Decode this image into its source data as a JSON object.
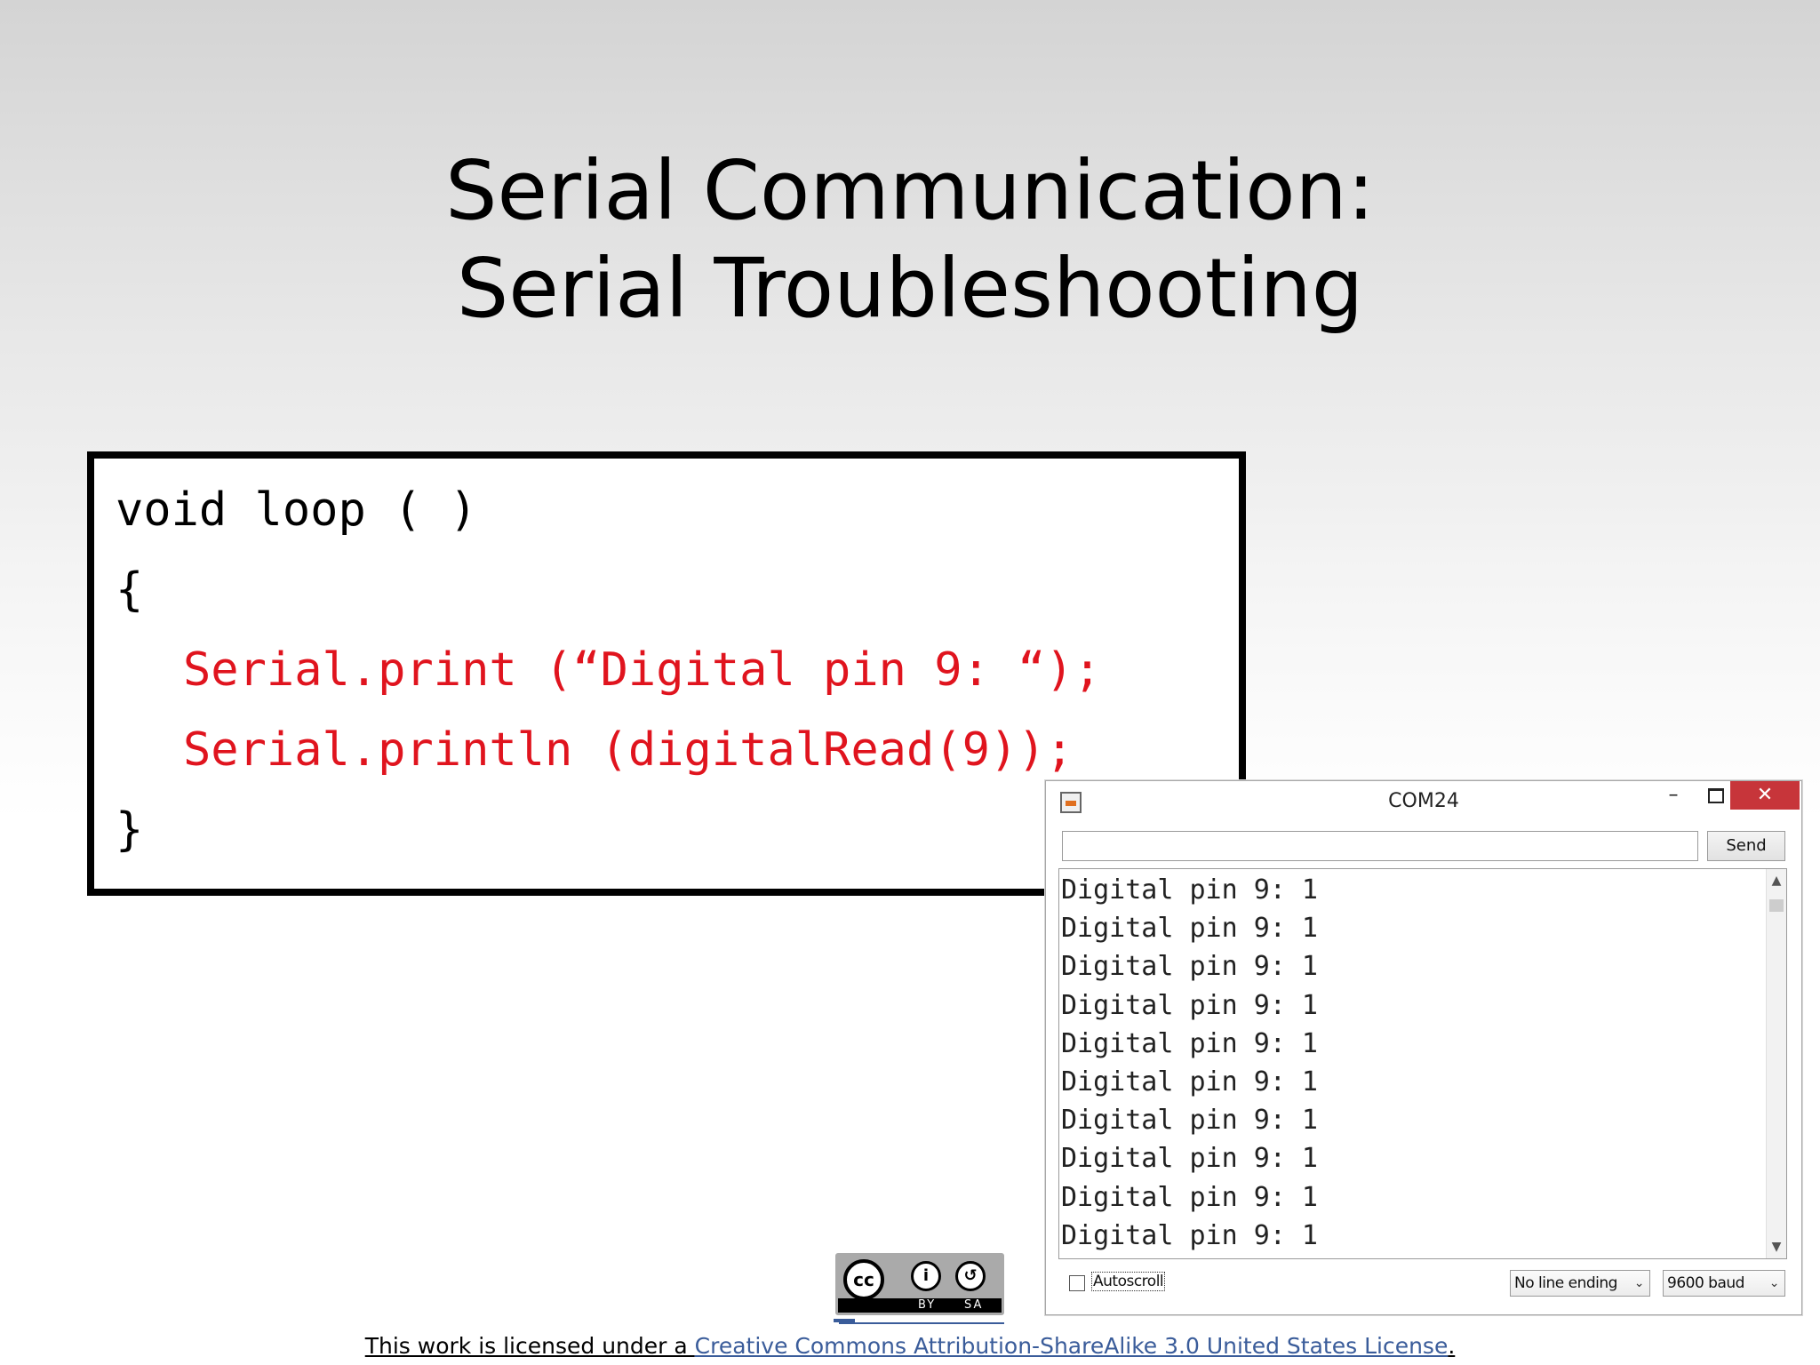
{
  "slide": {
    "title_line1": "Serial Communication:",
    "title_line2": "Serial Troubleshooting"
  },
  "code": {
    "line1": "void loop ( )",
    "line2": "{",
    "line3": "Serial.print (“Digital pin 9: “);",
    "line4": "Serial.println (digitalRead(9));",
    "line5": "}",
    "highlight_color": "#e0141e"
  },
  "serial_monitor": {
    "window_title": "COM24",
    "minimize_label": "–",
    "close_label": "✕",
    "input_value": "",
    "send_label": "Send",
    "output_lines": [
      "Digital pin 9: 1",
      "Digital pin 9: 1",
      "Digital pin 9: 1",
      "Digital pin 9: 1",
      "Digital pin 9: 1",
      "Digital pin 9: 1",
      "Digital pin 9: 1",
      "Digital pin 9: 1",
      "Digital pin 9: 1",
      "Digital pin 9: 1"
    ],
    "autoscroll_label": "Autoscroll",
    "autoscroll_checked": false,
    "line_ending_value": "No line ending",
    "baud_value": "9600 baud",
    "close_button_color": "#c7353a"
  },
  "license": {
    "badge_cc": "cc",
    "badge_by": "BY",
    "badge_sa": "SA",
    "prefix": "This work is licensed under a ",
    "link_text": "Creative Commons Attribution-ShareAlike 3.0 United States License",
    "suffix": ". ",
    "link_color": "#3a5c9a"
  }
}
